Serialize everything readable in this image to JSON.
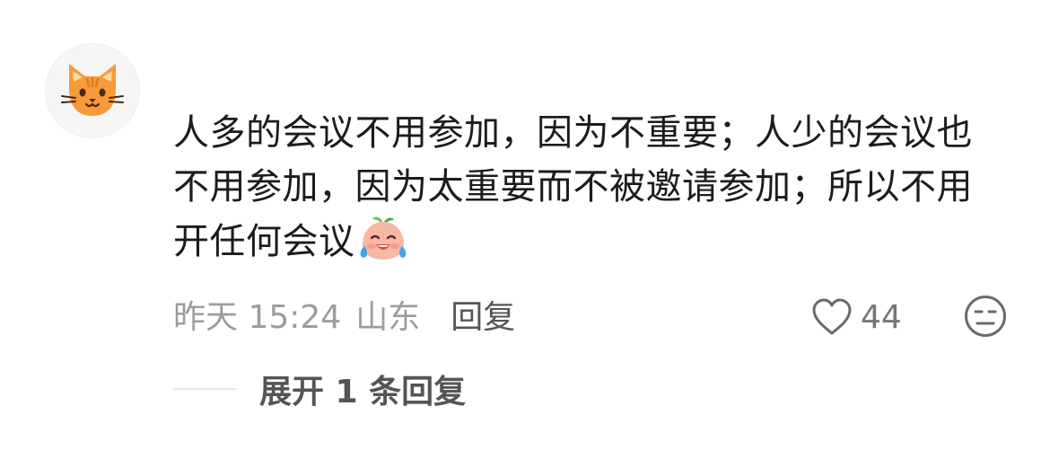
{
  "comment": {
    "avatar_icon": "orange-cat-face-icon",
    "text_line1": "人多的会议不用参加，因为不重要；人少的会议也",
    "text_line2": "不用参加，因为太重要而不被邀请参加；所以不用",
    "text_line3": "开任何会议",
    "emoji_icon": "laughing-with-tears-emoji",
    "time": "昨天 15:24",
    "location": "山东",
    "reply_label": "回复",
    "likes": "44",
    "expand_label": "展开 1 条回复"
  },
  "colors": {
    "text": "#1c1c1c",
    "meta": "#9d9d9d",
    "action": "#555555",
    "avatar_orange": "#f79a3a"
  }
}
